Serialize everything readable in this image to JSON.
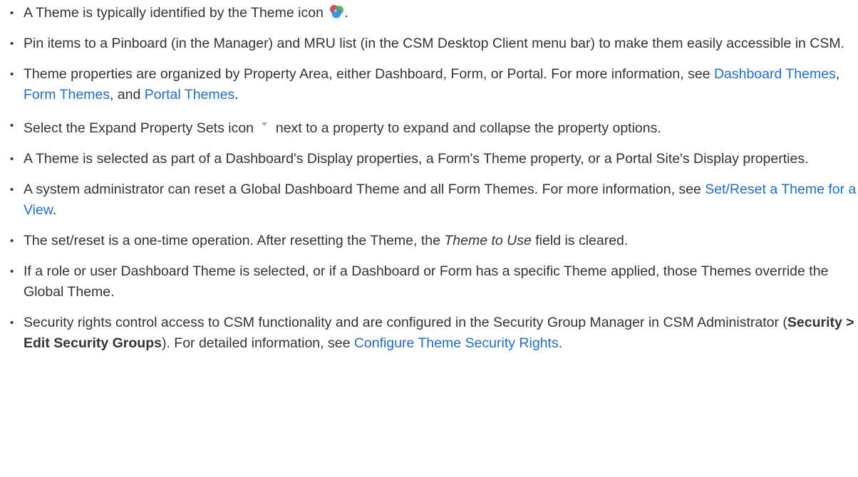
{
  "bullets": [
    {
      "pre": "A Theme is typically identified by the Theme icon ",
      "post": "."
    },
    {
      "text": "Pin items to a Pinboard (in the Manager) and MRU list (in the CSM Desktop Client menu bar) to make them easily accessible in CSM."
    },
    {
      "pre": "Theme properties are organized by Property Area, either Dashboard, Form, or Portal. For more information, see ",
      "link1": "Dashboard Themes",
      "sep1": ", ",
      "link2": "Form Themes",
      "sep2": ", and ",
      "link3": "Portal Themes",
      "post": "."
    },
    {
      "pre": "Select the Expand Property Sets icon ",
      "post": " next to a property to expand and collapse the property options."
    },
    {
      "text": "A Theme is selected as part of a Dashboard's Display properties, a Form's Theme property, or a Portal Site's Display properties."
    },
    {
      "pre": "A system administrator can reset a Global Dashboard Theme and all Form Themes. For more information, see ",
      "link": "Set/Reset a Theme for a View",
      "post": "."
    },
    {
      "pre": "The set/reset is a one-time operation. After resetting the Theme, the ",
      "em": "Theme to Use",
      "post": " field is cleared."
    },
    {
      "text": "If a role or user Dashboard Theme is selected, or if a Dashboard or Form has a specific Theme applied, those Themes override the Global Theme."
    },
    {
      "pre": "Security rights control access to CSM functionality and are configured in the Security Group Manager in CSM Administrator (",
      "strong": "Security > Edit Security Groups",
      "mid": "). For detailed information, see ",
      "link": "Configure Theme Security Rights",
      "post": "."
    }
  ],
  "colors": {
    "text": "#333333",
    "link": "#1a6fd9"
  },
  "icons": {
    "theme": "theme-icon",
    "expand": "expand-property-sets-icon"
  }
}
